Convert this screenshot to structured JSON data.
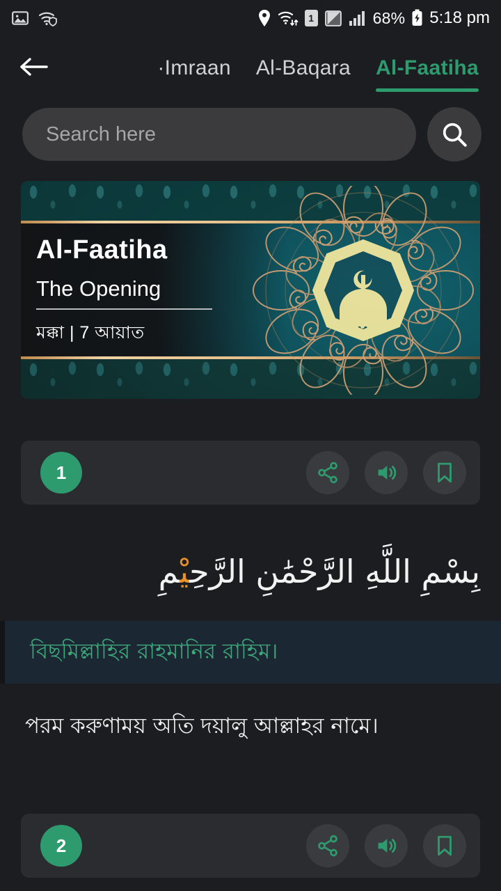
{
  "status_bar": {
    "left_icons": [
      "photo-icon",
      "wifi-shield-icon"
    ],
    "right_icons": [
      "location-pin-icon",
      "wifi-transfer-icon",
      "sim-1-icon",
      "half-square-icon",
      "signal-bars-icon"
    ],
    "sim_label": "1",
    "battery_percent": "68%",
    "time": "5:18 pm"
  },
  "nav": {
    "back_icon": "arrow-left-icon",
    "tabs": [
      {
        "label": "·Imraan",
        "active": false
      },
      {
        "label": "Al-Baqara",
        "active": false
      },
      {
        "label": "Al-Faatiha",
        "active": true
      }
    ]
  },
  "search": {
    "placeholder": "Search here",
    "value": "",
    "button_icon": "search-icon"
  },
  "surah_banner": {
    "title": "Al-Faatiha",
    "subtitle": "The Opening",
    "revelation_place": "মক্কা",
    "separator": "|",
    "ayah_count": "7 আয়াত",
    "meta": "মক্কা  |  7 আয়াত",
    "ornament_icon": "mosque-mandala-ornament"
  },
  "verses": [
    {
      "number": "1",
      "actions": [
        {
          "icon": "share-icon",
          "name": "share"
        },
        {
          "icon": "volume-icon",
          "name": "play-audio"
        },
        {
          "icon": "bookmark-icon",
          "name": "bookmark"
        }
      ],
      "arabic_before": "بِسْمِ اللَّهِ الرَّحْمَٰنِ الرَّحِ",
      "arabic_tajweed": "یْ",
      "arabic_after": "مِ",
      "transliteration": "বিছমিল্লাহির রাহমানির রাহিম।",
      "translation": "পরম করুণাময় অতি দয়ালু আল্লাহর নামে।"
    },
    {
      "number": "2",
      "actions": [
        {
          "icon": "share-icon",
          "name": "share"
        },
        {
          "icon": "volume-icon",
          "name": "play-audio"
        },
        {
          "icon": "bookmark-icon",
          "name": "bookmark"
        }
      ]
    }
  ],
  "colors": {
    "accent_green": "#2e9b6e",
    "translit_green": "#3fa87b",
    "tajweed_orange": "#e8912a",
    "background": "#1c1d21",
    "card": "#2b2c30",
    "band": "#1b2733",
    "gold": "#e8c28f"
  }
}
